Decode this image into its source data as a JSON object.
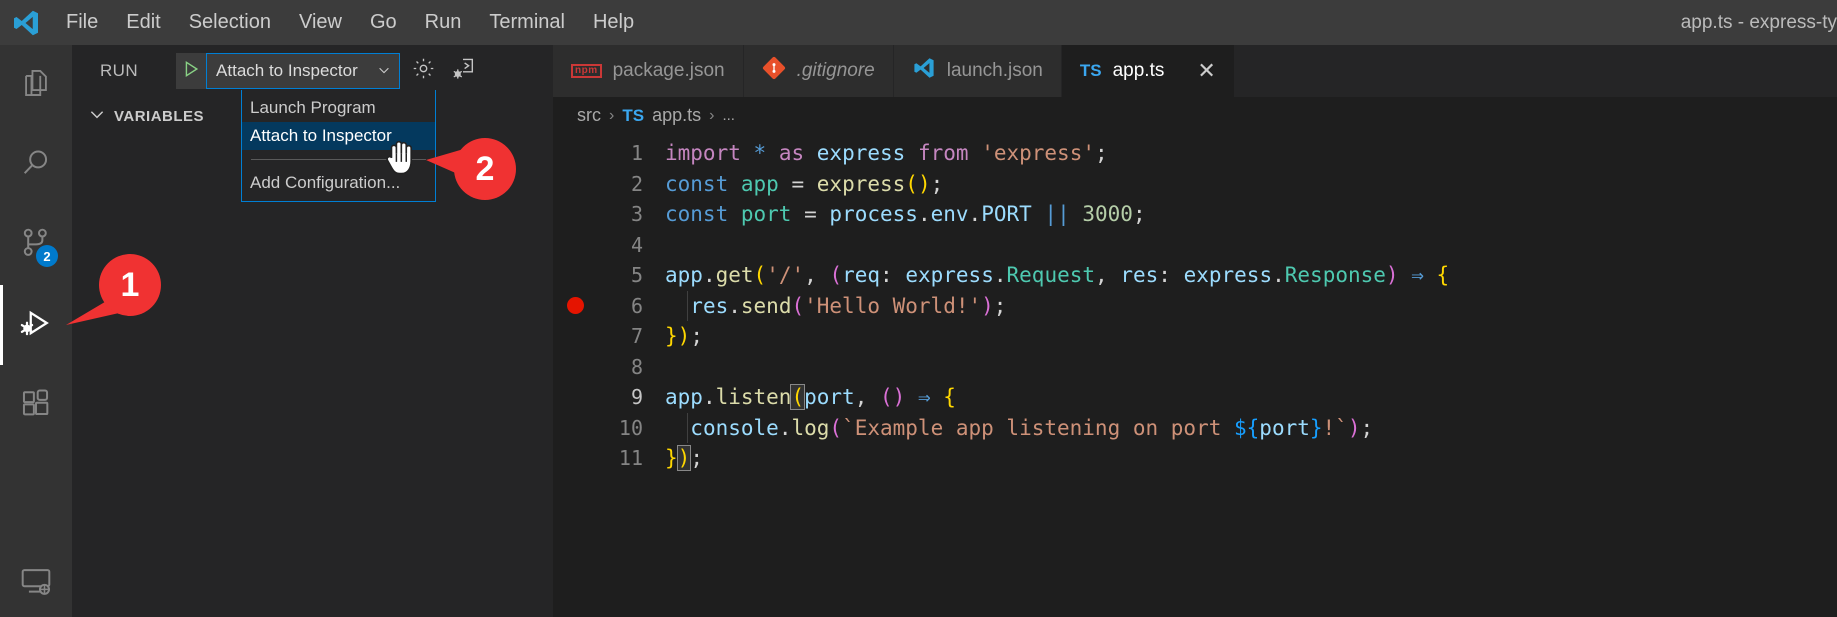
{
  "window": {
    "title": "app.ts - express-ty",
    "logo_icon": "vscode-logo-icon"
  },
  "menubar": {
    "items": [
      {
        "label": "File"
      },
      {
        "label": "Edit"
      },
      {
        "label": "Selection"
      },
      {
        "label": "View"
      },
      {
        "label": "Go"
      },
      {
        "label": "Run"
      },
      {
        "label": "Terminal"
      },
      {
        "label": "Help"
      }
    ]
  },
  "activity_bar": {
    "items": [
      {
        "name": "explorer",
        "icon": "files-icon",
        "badge": null,
        "active": false
      },
      {
        "name": "search",
        "icon": "search-icon",
        "badge": null,
        "active": false
      },
      {
        "name": "source-control",
        "icon": "source-control-icon",
        "badge": "2",
        "active": false
      },
      {
        "name": "run-and-debug",
        "icon": "run-and-debug-icon",
        "badge": null,
        "active": true
      },
      {
        "name": "extensions",
        "icon": "extensions-icon",
        "badge": null,
        "active": false
      }
    ],
    "bottom_items": [
      {
        "name": "remote-explorer",
        "icon": "remote-explorer-icon"
      }
    ]
  },
  "sidebar": {
    "title": "RUN",
    "start_debug_icon": "play-triangle-icon",
    "config_select": {
      "value": "Attach to Inspector",
      "chevron_icon": "chevron-down-icon"
    },
    "gear_icon": "gear-icon",
    "repl_icon": "open-debug-console-icon",
    "sections": [
      {
        "label": "VARIABLES",
        "chevron_icon": "chevron-down-icon",
        "expanded": true
      }
    ]
  },
  "dropdown": {
    "options": [
      {
        "label": "Launch Program",
        "selected": false
      },
      {
        "label": "Attach to Inspector",
        "selected": true
      }
    ],
    "footer_options": [
      {
        "label": "Add Configuration...",
        "selected": false
      }
    ]
  },
  "editor": {
    "tabs": [
      {
        "label": "package.json",
        "icon": "npm-icon",
        "icon_text": "npm",
        "active": false,
        "italic": false,
        "closable": false
      },
      {
        "label": ".gitignore",
        "icon": "git-icon",
        "active": false,
        "italic": true,
        "closable": false
      },
      {
        "label": "launch.json",
        "icon": "vscode-json-icon",
        "active": false,
        "italic": false,
        "closable": false
      },
      {
        "label": "app.ts",
        "icon": "typescript-icon",
        "icon_text": "TS",
        "active": true,
        "italic": false,
        "closable": true,
        "close_icon": "close-icon"
      }
    ],
    "breadcrumb": [
      {
        "label": "src",
        "icon": null
      },
      {
        "label": "app.ts",
        "icon": "typescript-icon",
        "icon_text": "TS"
      },
      {
        "label": "...",
        "icon": null
      }
    ],
    "breadcrumb_separator": "›",
    "gutter_lines": [
      "1",
      "2",
      "3",
      "4",
      "5",
      "6",
      "7",
      "8",
      "9",
      "10",
      "11"
    ],
    "breakpoint_line": 6,
    "current_line": 9,
    "code": [
      "import * as express from 'express';",
      "const app = express();",
      "const port = process.env.PORT || 3000;",
      "",
      "app.get('/', (req: express.Request, res: express.Response) => {",
      "  res.send('Hello World!');",
      "});",
      "",
      "app.listen(port, () => {",
      "  console.log(`Example app listening on port ${port}!`);",
      "});"
    ]
  },
  "callouts": [
    {
      "number": "1",
      "target": "run-and-debug-activity-icon"
    },
    {
      "number": "2",
      "target": "attach-to-inspector-dropdown-option"
    }
  ],
  "colors": {
    "accent": "#007acc",
    "callout": "#f03232",
    "breakpoint": "#e51400",
    "focus_border": "#007fd4",
    "selection": "#04395e"
  }
}
